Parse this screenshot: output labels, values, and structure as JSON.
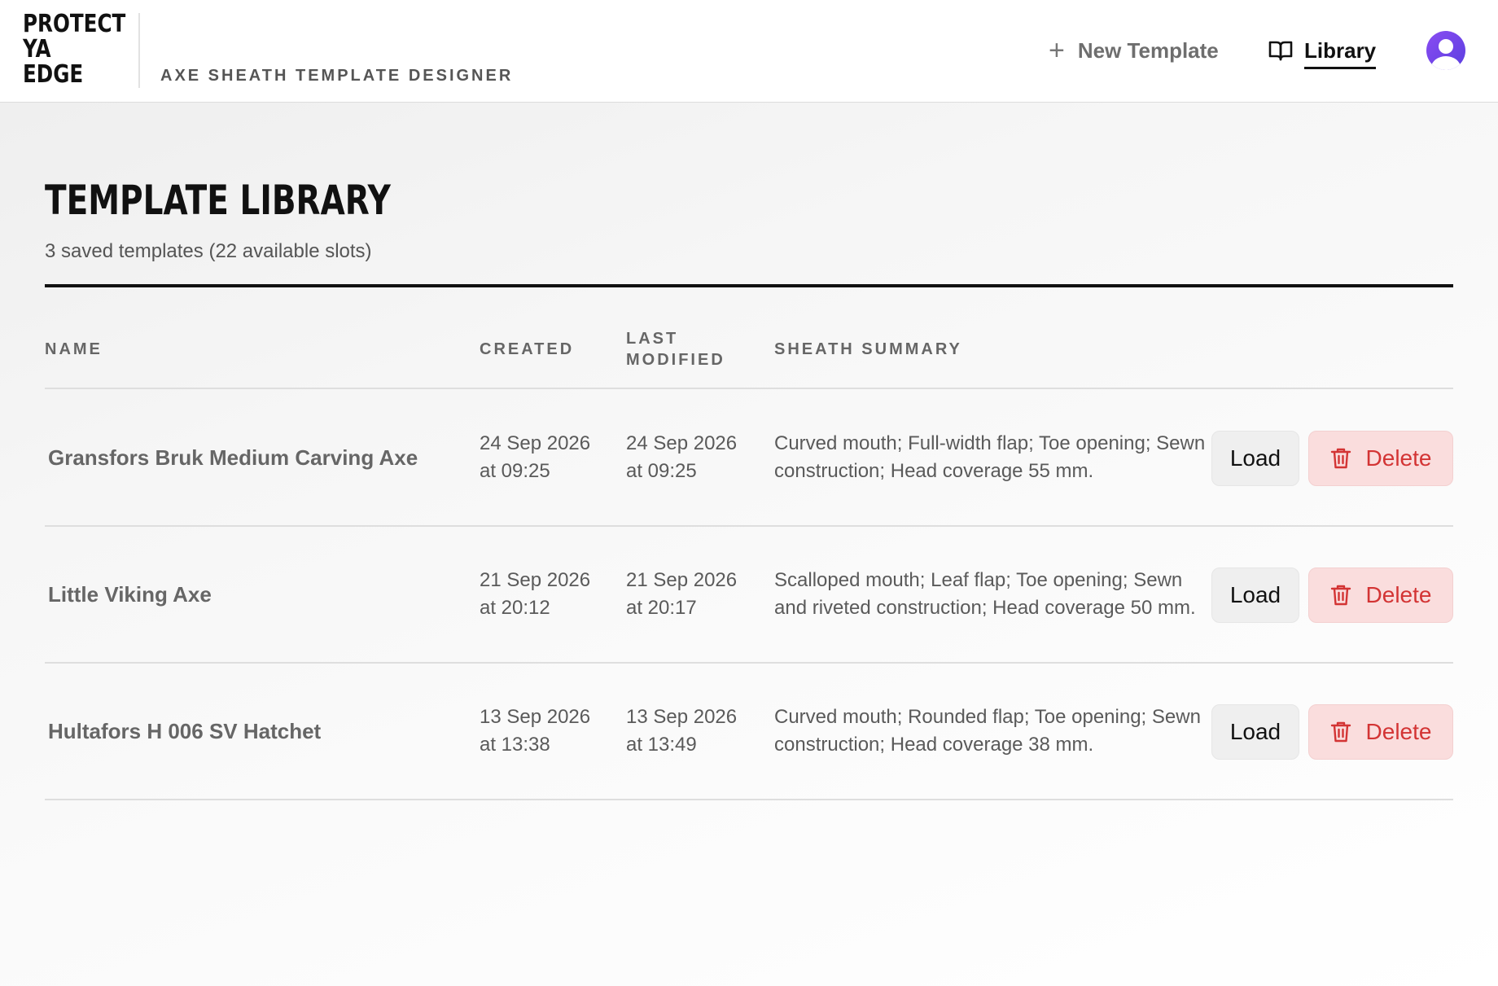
{
  "header": {
    "logo_lines": [
      "PROTECT",
      "YA",
      "EDGE"
    ],
    "subtitle": "AXE SHEATH TEMPLATE DESIGNER",
    "nav": {
      "new_template_label": "New Template",
      "library_label": "Library"
    },
    "icons": {
      "new_template": "plus-icon",
      "library": "book-open-icon",
      "avatar": "user-avatar-icon",
      "delete": "trash-icon"
    }
  },
  "page": {
    "title": "TEMPLATE LIBRARY",
    "count_text": "3 saved templates (22 available slots)"
  },
  "table": {
    "headers": {
      "name": "NAME",
      "created": "CREATED",
      "modified": "LAST MODIFIED",
      "summary": "SHEATH SUMMARY"
    },
    "rows": [
      {
        "name": "Gransfors Bruk Medium Carving Axe",
        "created": "24 Sep 2026 at 09:25",
        "modified": "24 Sep 2026 at 09:25",
        "summary": "Curved mouth; Full-width flap; Toe opening; Sewn construction; Head coverage 55 mm."
      },
      {
        "name": "Little Viking Axe",
        "created": "21 Sep 2026 at 20:12",
        "modified": "21 Sep 2026 at 20:17",
        "summary": "Scalloped mouth; Leaf flap; Toe opening; Sewn and riveted construction; Head coverage 50 mm."
      },
      {
        "name": "Hultafors H 006 SV Hatchet",
        "created": "13 Sep 2026 at 13:38",
        "modified": "13 Sep 2026 at 13:49",
        "summary": "Curved mouth; Rounded flap; Toe opening; Sewn construction; Head coverage 38 mm."
      }
    ],
    "actions": {
      "load_label": "Load",
      "delete_label": "Delete"
    }
  },
  "colors": {
    "avatar": "#6f45ea",
    "delete_text": "#d33434",
    "delete_bg": "#fadddd",
    "load_bg": "#efefef"
  }
}
